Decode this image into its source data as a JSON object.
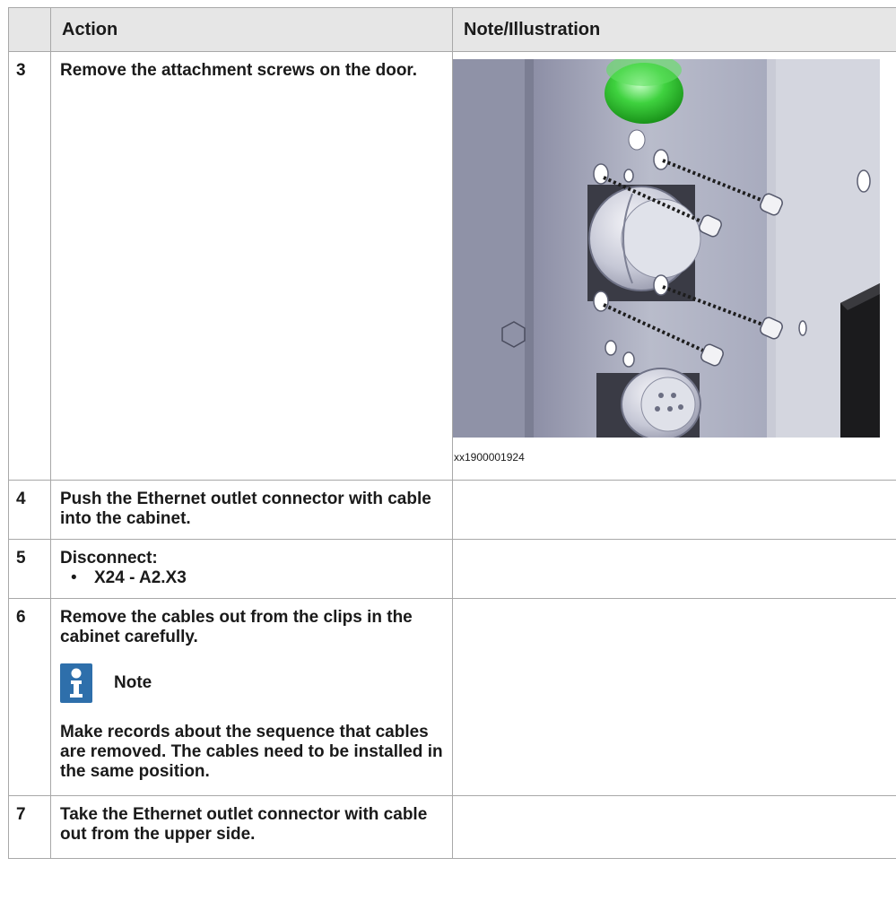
{
  "headers": {
    "col0": "",
    "action": "Action",
    "note": "Note/Illustration"
  },
  "rows": [
    {
      "num": "3",
      "action": "Remove the attachment screws on the door.",
      "figure_caption": "xx1900001924"
    },
    {
      "num": "4",
      "action": "Push the Ethernet outlet connector with cable into the cabinet."
    },
    {
      "num": "5",
      "action": "Disconnect:",
      "bullets": [
        "X24 - A2.X3"
      ]
    },
    {
      "num": "6",
      "action": "Remove the cables out from the clips in the cabinet carefully.",
      "note_label": "Note",
      "note_text": "Make records about the sequence that cables are removed. The cables need to be installed in the same position.",
      "note_icon": "info-icon"
    },
    {
      "num": "7",
      "action": "Take the Ethernet outlet connector with cable out from the upper side."
    }
  ],
  "colors": {
    "header_bg": "#e6e6e6",
    "border": "#a8a8a8",
    "info_icon": "#2e6fab",
    "knob": "#3fd23f"
  }
}
